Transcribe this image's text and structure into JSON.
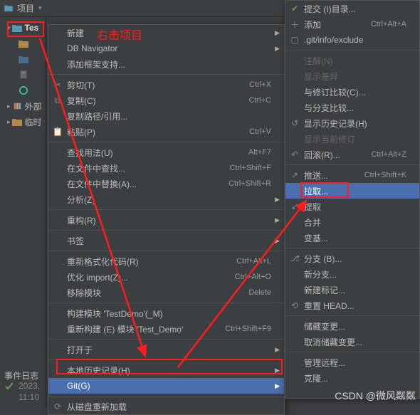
{
  "header": {
    "project_label": "项目",
    "dropdown": "▾"
  },
  "tree": {
    "root": "Tes",
    "external": "外部",
    "scratches": "临时"
  },
  "annotation": {
    "right_click": "右击项目"
  },
  "context_menu": {
    "new": "新建",
    "dbnav": "DB Navigator",
    "addframe": "添加框架支持...",
    "cut": "剪切(T)",
    "cut_k": "Ctrl+X",
    "copy": "复制(C)",
    "copy_k": "Ctrl+C",
    "copypath": "复制路径/引用...",
    "paste": "粘贴(P)",
    "paste_k": "Ctrl+V",
    "findusages": "查找用法(U)",
    "findusages_k": "Alt+F7",
    "findinfiles": "在文件中查找...",
    "findinfiles_k": "Ctrl+Shift+F",
    "replaceinfiles": "在文件中替换(A)...",
    "replaceinfiles_k": "Ctrl+Shift+R",
    "analyze": "分析(Z)",
    "refactor": "重构(R)",
    "bookmark": "书签",
    "reformat": "重新格式化代码(R)",
    "reformat_k": "Ctrl+Alt+L",
    "optimport": "优化 import(Z)...",
    "optimport_k": "Ctrl+Alt+O",
    "removemod": "移除模块",
    "removemod_k": "Delete",
    "buildmod": "构建模块 'TestDemo'(_M)",
    "rebuildmod": "重新构建 (E) 模块 'Test_Demo'",
    "rebuildmod_k": "Ctrl+Shift+F9",
    "openin": "打开于",
    "localhist": "本地历史记录(H)",
    "git": "Git(G)",
    "reloaddisk": "从磁盘重新加载"
  },
  "git_menu": {
    "commitdir": "提交 (I)目录...",
    "add": "添加",
    "add_k": "Ctrl+Alt+A",
    "exclude": ".git/info/exclude",
    "annotate": "注解(N)",
    "showdiff": "显示差异",
    "compare_rev": "与修订比较(C)...",
    "compare_branch": "与分支比较...",
    "showhist": "显示历史记录(H)",
    "showcurrev": "显示当前修订",
    "rollback": "回滚(R)...",
    "rollback_k": "Ctrl+Alt+Z",
    "push": "推送...",
    "push_k": "Ctrl+Shift+K",
    "pull": "拉取...",
    "fetch": "提取",
    "merge": "合并",
    "rebase": "变基...",
    "branches": "分支 (B)...",
    "newbranch": "新分支...",
    "newtag": "新建标记...",
    "resethead": "重置 HEAD...",
    "stash": "储藏变更...",
    "unstash": "取消储藏变更...",
    "manageremote": "管理远程...",
    "clone": "克隆..."
  },
  "bottom": {
    "event_log": "事件日志",
    "date": "2023,",
    "time": "11:10"
  },
  "watermark": "CSDN @微风粼粼"
}
